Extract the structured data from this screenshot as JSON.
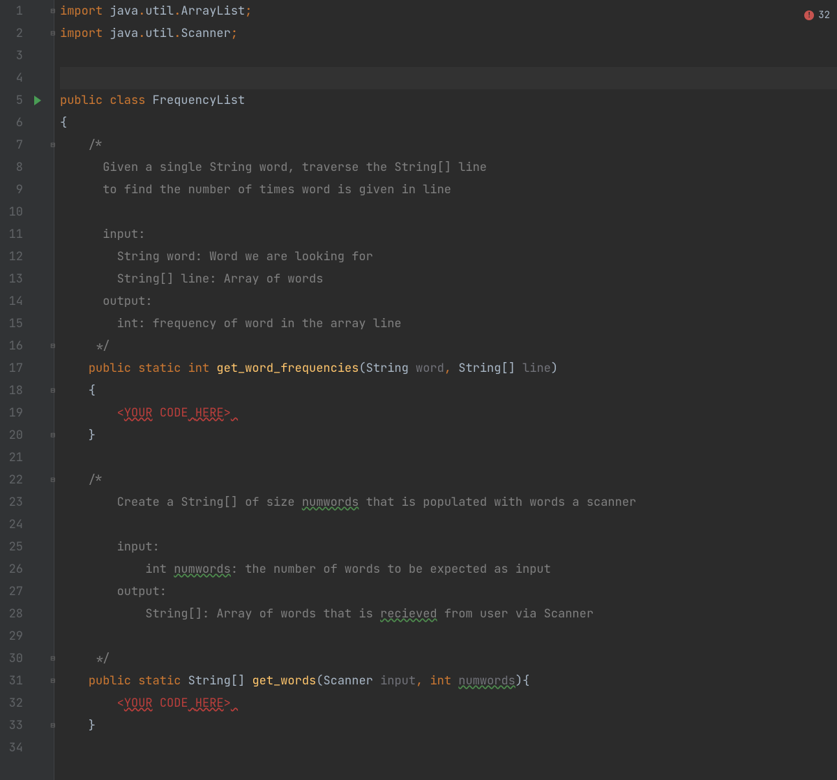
{
  "errorBadge": {
    "count": "32"
  },
  "lines": [
    {
      "n": "1",
      "fold": "down",
      "tokens": [
        [
          "kw",
          "import"
        ],
        [
          "ident",
          " java"
        ],
        [
          "semi",
          "."
        ],
        [
          "ident",
          "util"
        ],
        [
          "semi",
          "."
        ],
        [
          "ident",
          "ArrayList"
        ],
        [
          "semi",
          ";"
        ]
      ]
    },
    {
      "n": "2",
      "fold": "down",
      "tokens": [
        [
          "kw",
          "import"
        ],
        [
          "ident",
          " java"
        ],
        [
          "semi",
          "."
        ],
        [
          "ident",
          "util"
        ],
        [
          "semi",
          "."
        ],
        [
          "ident",
          "Scanner"
        ],
        [
          "semi",
          ";"
        ]
      ]
    },
    {
      "n": "3",
      "tokens": []
    },
    {
      "n": "4",
      "highlight": true,
      "tokens": []
    },
    {
      "n": "5",
      "run": true,
      "tokens": [
        [
          "kw",
          "public class "
        ],
        [
          "ident",
          "FrequencyList"
        ]
      ]
    },
    {
      "n": "6",
      "tokens": [
        [
          "ident",
          "{"
        ]
      ]
    },
    {
      "n": "7",
      "fold": "down",
      "tokens": [
        [
          "ident",
          "    "
        ],
        [
          "comment",
          "/*"
        ]
      ]
    },
    {
      "n": "8",
      "tokens": [
        [
          "ident",
          "      "
        ],
        [
          "comment",
          "Given a single String word, traverse the String[] line"
        ]
      ]
    },
    {
      "n": "9",
      "tokens": [
        [
          "ident",
          "      "
        ],
        [
          "comment",
          "to find the number of times word is given in line"
        ]
      ]
    },
    {
      "n": "10",
      "tokens": []
    },
    {
      "n": "11",
      "tokens": [
        [
          "ident",
          "      "
        ],
        [
          "comment",
          "input:"
        ]
      ]
    },
    {
      "n": "12",
      "tokens": [
        [
          "ident",
          "        "
        ],
        [
          "comment",
          "String word: Word we are looking for"
        ]
      ]
    },
    {
      "n": "13",
      "tokens": [
        [
          "ident",
          "        "
        ],
        [
          "comment",
          "String[] line: Array of words"
        ]
      ]
    },
    {
      "n": "14",
      "tokens": [
        [
          "ident",
          "      "
        ],
        [
          "comment",
          "output:"
        ]
      ]
    },
    {
      "n": "15",
      "tokens": [
        [
          "ident",
          "        "
        ],
        [
          "comment",
          "int: frequency of word in the array line"
        ]
      ]
    },
    {
      "n": "16",
      "fold": "up",
      "tokens": [
        [
          "ident",
          "     "
        ],
        [
          "comment",
          "*/"
        ]
      ]
    },
    {
      "n": "17",
      "tokens": [
        [
          "ident",
          "    "
        ],
        [
          "kw",
          "public static int "
        ],
        [
          "method-decl",
          "get_word_frequencies"
        ],
        [
          "ident",
          "("
        ],
        [
          "ident",
          "String "
        ],
        [
          "param",
          "word"
        ],
        [
          "semi",
          ", "
        ],
        [
          "ident",
          "String[] "
        ],
        [
          "param",
          "line"
        ],
        [
          "ident",
          ")"
        ]
      ]
    },
    {
      "n": "18",
      "fold": "down",
      "tokens": [
        [
          "ident",
          "    {"
        ]
      ]
    },
    {
      "n": "19",
      "tokens": [
        [
          "ident",
          "        "
        ],
        [
          "placeholder",
          "<"
        ],
        [
          "placeholder-err",
          "YOUR"
        ],
        [
          "placeholder",
          " CODE"
        ],
        [
          "placeholder-sp",
          " "
        ],
        [
          "placeholder-err",
          "HERE"
        ],
        [
          "placeholder",
          ">"
        ],
        [
          "placeholder-sp",
          " "
        ]
      ]
    },
    {
      "n": "20",
      "fold": "up",
      "tokens": [
        [
          "ident",
          "    }"
        ]
      ]
    },
    {
      "n": "21",
      "tokens": []
    },
    {
      "n": "22",
      "fold": "down",
      "tokens": [
        [
          "ident",
          "    "
        ],
        [
          "comment",
          "/*"
        ]
      ]
    },
    {
      "n": "23",
      "tokens": [
        [
          "ident",
          "        "
        ],
        [
          "comment",
          "Create a String[] of size "
        ],
        [
          "comment-typo",
          "numwords"
        ],
        [
          "comment",
          " that is populated with words a scanner"
        ]
      ]
    },
    {
      "n": "24",
      "tokens": []
    },
    {
      "n": "25",
      "tokens": [
        [
          "ident",
          "        "
        ],
        [
          "comment",
          "input:"
        ]
      ]
    },
    {
      "n": "26",
      "tokens": [
        [
          "ident",
          "            "
        ],
        [
          "comment",
          "int "
        ],
        [
          "comment-typo",
          "numwords"
        ],
        [
          "comment",
          ": the number of words to be expected as input"
        ]
      ]
    },
    {
      "n": "27",
      "tokens": [
        [
          "ident",
          "        "
        ],
        [
          "comment",
          "output:"
        ]
      ]
    },
    {
      "n": "28",
      "tokens": [
        [
          "ident",
          "            "
        ],
        [
          "comment",
          "String[]: Array of words that is "
        ],
        [
          "comment-typo",
          "recieved"
        ],
        [
          "comment",
          " from user via Scanner"
        ]
      ]
    },
    {
      "n": "29",
      "tokens": []
    },
    {
      "n": "30",
      "fold": "up",
      "tokens": [
        [
          "ident",
          "     "
        ],
        [
          "comment",
          "*/"
        ]
      ]
    },
    {
      "n": "31",
      "fold": "down",
      "tokens": [
        [
          "ident",
          "    "
        ],
        [
          "kw",
          "public static "
        ],
        [
          "ident",
          "String[] "
        ],
        [
          "method-decl",
          "get_words"
        ],
        [
          "ident",
          "("
        ],
        [
          "ident",
          "Scanner "
        ],
        [
          "param",
          "input"
        ],
        [
          "semi",
          ", "
        ],
        [
          "kw",
          "int "
        ],
        [
          "param-typo",
          "numwords"
        ],
        [
          "ident",
          "){"
        ]
      ]
    },
    {
      "n": "32",
      "tokens": [
        [
          "ident",
          "        "
        ],
        [
          "placeholder",
          "<"
        ],
        [
          "placeholder-err",
          "YOUR"
        ],
        [
          "placeholder",
          " CODE"
        ],
        [
          "placeholder-sp",
          " "
        ],
        [
          "placeholder-err",
          "HERE"
        ],
        [
          "placeholder",
          ">"
        ],
        [
          "placeholder-sp",
          " "
        ]
      ]
    },
    {
      "n": "33",
      "fold": "up",
      "tokens": [
        [
          "ident",
          "    }"
        ]
      ]
    },
    {
      "n": "34",
      "tokens": []
    }
  ]
}
